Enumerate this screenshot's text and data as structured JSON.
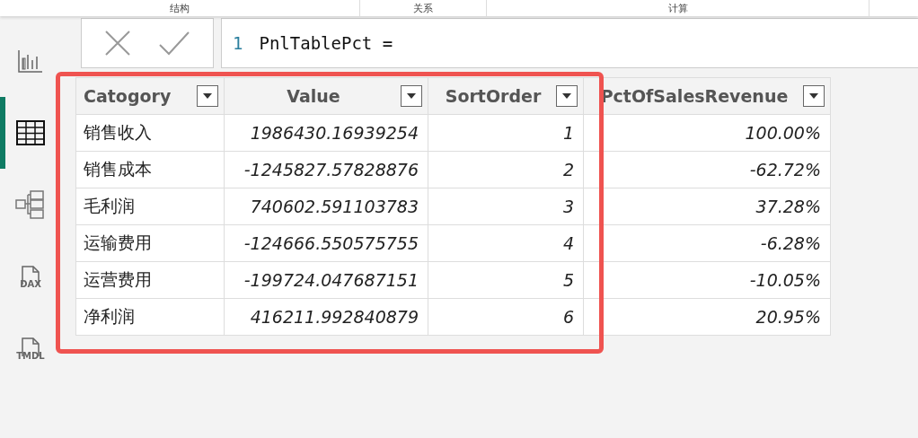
{
  "top_tabs": [
    {
      "label": "结构"
    },
    {
      "label": "关系"
    },
    {
      "label": "计算"
    }
  ],
  "sidebar": {
    "items": [
      {
        "kind": "report",
        "selected": false
      },
      {
        "kind": "table",
        "selected": true
      },
      {
        "kind": "model",
        "selected": false
      },
      {
        "kind": "dax",
        "label": "DAX",
        "selected": false
      },
      {
        "kind": "tmdl",
        "label": "TMDL",
        "selected": false
      }
    ]
  },
  "formula_bar": {
    "line_number": "1",
    "code": "PnlTablePct ="
  },
  "table": {
    "columns": [
      {
        "label": "Catogory",
        "kind": "text"
      },
      {
        "label": "Value",
        "kind": "number"
      },
      {
        "label": "SortOrder",
        "kind": "number"
      },
      {
        "label": "PctOfSalesRevenue",
        "kind": "number"
      }
    ],
    "rows": [
      [
        "销售收入",
        "1986430.16939254",
        "1",
        "100.00%"
      ],
      [
        "销售成本",
        "-1245827.57828876",
        "2",
        "-62.72%"
      ],
      [
        "毛利润",
        "740602.591103783",
        "3",
        "37.28%"
      ],
      [
        "运输费用",
        "-124666.550575755",
        "4",
        "-6.28%"
      ],
      [
        "运营费用",
        "-199724.047687151",
        "5",
        "-10.05%"
      ],
      [
        "净利润",
        "416211.992840879",
        "6",
        "20.95%"
      ]
    ]
  },
  "highlight": {
    "color": "#ef5350"
  }
}
